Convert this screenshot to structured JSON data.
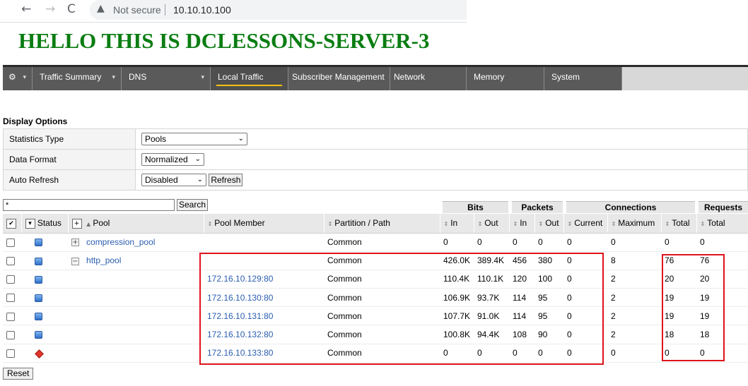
{
  "browser": {
    "back_icon": "←",
    "forward_icon": "→",
    "reload_icon": "C",
    "warning_icon": "▲",
    "security_label": "Not secure",
    "url": "10.10.10.100"
  },
  "page_heading": "HELLO THIS IS DCLESSONS-SERVER-3",
  "menu": {
    "gear_icon": "⚙",
    "dropdown_icon": "▾",
    "tabs": [
      {
        "label": "Traffic Summary",
        "has_dropdown": true
      },
      {
        "label": "DNS",
        "has_dropdown": true
      },
      {
        "label": "Local Traffic",
        "active": true
      },
      {
        "label": "Subscriber Management"
      },
      {
        "label": "Network"
      },
      {
        "label": "Memory"
      },
      {
        "label": "System"
      }
    ],
    "accent_color": "#ffc20e"
  },
  "display_options": {
    "title": "Display Options",
    "statistics_type": {
      "label": "Statistics Type",
      "value": "Pools"
    },
    "data_format": {
      "label": "Data Format",
      "value": "Normalized"
    },
    "auto_refresh": {
      "label": "Auto Refresh",
      "value": "Disabled",
      "refresh_label": "Refresh"
    }
  },
  "search": {
    "value": "*",
    "button_label": "Search"
  },
  "stats": {
    "groups": {
      "bits": "Bits",
      "packets": "Packets",
      "connections": "Connections",
      "requests": "Requests"
    },
    "columns": {
      "status": "Status",
      "pool": "Pool",
      "pool_member": "Pool Member",
      "partition": "Partition / Path",
      "bits_in": "In",
      "bits_out": "Out",
      "packets_in": "In",
      "packets_out": "Out",
      "conn_current": "Current",
      "conn_maximum": "Maximum",
      "conn_total": "Total",
      "req_total": "Total"
    },
    "rows": [
      {
        "status": "blue",
        "expander": "+",
        "pool": "compression_pool",
        "member": "",
        "partition": "Common",
        "bits_in": "0",
        "bits_out": "0",
        "pkts_in": "0",
        "pkts_out": "0",
        "current": "0",
        "maximum": "0",
        "total": "0",
        "requests": "0"
      },
      {
        "status": "blue",
        "expander": "−",
        "pool": "http_pool",
        "member": "",
        "partition": "Common",
        "bits_in": "426.0K",
        "bits_out": "389.4K",
        "pkts_in": "456",
        "pkts_out": "380",
        "current": "0",
        "maximum": "8",
        "total": "76",
        "requests": "76"
      },
      {
        "status": "blue",
        "expander": "",
        "pool": "",
        "member": "172.16.10.129:80",
        "partition": "Common",
        "bits_in": "110.4K",
        "bits_out": "110.1K",
        "pkts_in": "120",
        "pkts_out": "100",
        "current": "0",
        "maximum": "2",
        "total": "20",
        "requests": "20"
      },
      {
        "status": "blue",
        "expander": "",
        "pool": "",
        "member": "172.16.10.130:80",
        "partition": "Common",
        "bits_in": "106.9K",
        "bits_out": "93.7K",
        "pkts_in": "114",
        "pkts_out": "95",
        "current": "0",
        "maximum": "2",
        "total": "19",
        "requests": "19"
      },
      {
        "status": "blue",
        "expander": "",
        "pool": "",
        "member": "172.16.10.131:80",
        "partition": "Common",
        "bits_in": "107.7K",
        "bits_out": "91.0K",
        "pkts_in": "114",
        "pkts_out": "95",
        "current": "0",
        "maximum": "2",
        "total": "19",
        "requests": "19"
      },
      {
        "status": "blue",
        "expander": "",
        "pool": "",
        "member": "172.16.10.132:80",
        "partition": "Common",
        "bits_in": "100.8K",
        "bits_out": "94.4K",
        "pkts_in": "108",
        "pkts_out": "90",
        "current": "0",
        "maximum": "2",
        "total": "18",
        "requests": "18"
      },
      {
        "status": "red",
        "expander": "",
        "pool": "",
        "member": "172.16.10.133:80",
        "partition": "Common",
        "bits_in": "0",
        "bits_out": "0",
        "pkts_in": "0",
        "pkts_out": "0",
        "current": "0",
        "maximum": "0",
        "total": "0",
        "requests": "0"
      }
    ]
  },
  "reset_label": "Reset",
  "colors": {
    "heading": "#0a7d12",
    "highlight": "#e0121b",
    "link": "#2a5db0",
    "status_up": "#2f6fc9",
    "status_down": "#e0352b"
  }
}
